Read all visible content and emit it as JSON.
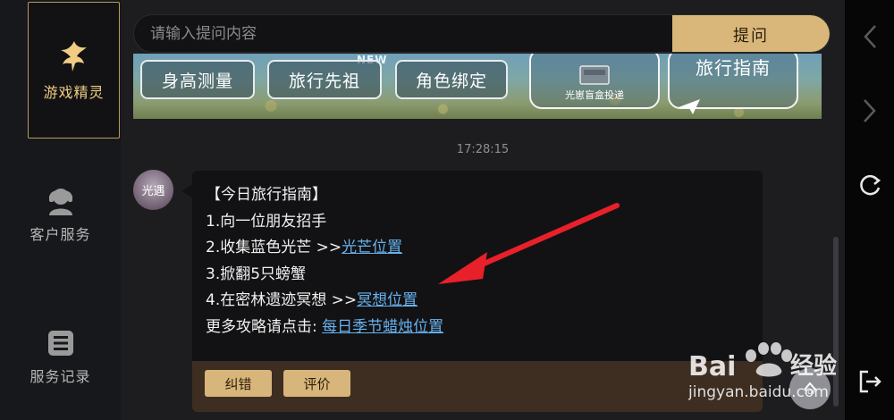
{
  "sidebar": {
    "items": [
      {
        "label": "游戏精灵",
        "icon": "fairy-icon",
        "active": true
      },
      {
        "label": "客户服务",
        "icon": "headset-agent-icon",
        "active": false
      },
      {
        "label": "服务记录",
        "icon": "list-record-icon",
        "active": false
      }
    ]
  },
  "search": {
    "placeholder": "请输入提问内容",
    "value": "",
    "submit_label": "提问"
  },
  "banner": {
    "new_tag": "NEW",
    "chips": [
      "身高测量",
      "旅行先祖",
      "角色绑定"
    ],
    "cards": [
      {
        "label": "光崽盲盒投递"
      },
      {
        "label": "旅行指南"
      }
    ]
  },
  "chat": {
    "timestamp": "17:28:15",
    "avatar_text": "光遇",
    "message": {
      "title": "【今日旅行指南】",
      "line1": "1.向一位朋友招手",
      "line2_text": "2.收集蓝色光芒 >>",
      "line2_link": "光芒位置",
      "line3": "3.掀翻5只螃蟹",
      "line4_text": "4.在密林遗迹冥想 >>",
      "line4_link": "冥想位置",
      "line5_text": "更多攻略请点击: ",
      "line5_link": "每日季节蜡烛位置"
    },
    "actions": [
      "纠错",
      "评价"
    ]
  },
  "top_button": {
    "label": "TOP"
  },
  "watermark": {
    "brand": "Bai",
    "brand2": "经验",
    "url": "jingyan.baidu.com"
  },
  "colors": {
    "accent": "#d9b77a",
    "link": "#67b2ee",
    "active_label": "#f0cd82",
    "annotation_arrow": "#e8202a"
  }
}
